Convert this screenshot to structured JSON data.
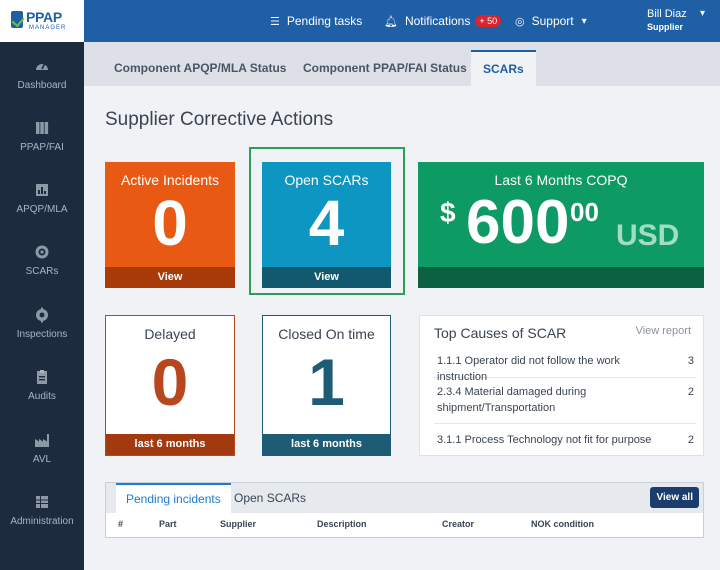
{
  "app": {
    "logo_text": "PPAP",
    "logo_sub": "MANAGER"
  },
  "topnav": {
    "pending_label": "Pending tasks",
    "pending_icon": "list-icon",
    "notifications_label": "Notifications",
    "notifications_badge": "+ 50",
    "notifications_icon": "bell-icon",
    "support_label": "Support",
    "support_icon": "headset-icon"
  },
  "user": {
    "name": "Bill Diaz",
    "role": "Supplier"
  },
  "sidebar": {
    "items": [
      {
        "label": "Dashboard",
        "icon": "speedometer-icon"
      },
      {
        "label": "PPAP/FAI",
        "icon": "binders-icon"
      },
      {
        "label": "APQP/MLA",
        "icon": "chart-doc-icon"
      },
      {
        "label": "SCARs",
        "icon": "target-icon"
      },
      {
        "label": "Inspections",
        "icon": "gear-check-icon"
      },
      {
        "label": "Audits",
        "icon": "clipboard-icon"
      },
      {
        "label": "AVL",
        "icon": "factory-icon"
      },
      {
        "label": "Administration",
        "icon": "table-icon"
      }
    ]
  },
  "tabs": [
    {
      "label": "Component APQP/MLA Status"
    },
    {
      "label": "Component PPAP/FAI Status"
    },
    {
      "label": "SCARs"
    }
  ],
  "page_title": "Supplier Corrective Actions",
  "cards": {
    "active": {
      "title": "Active Incidents",
      "value": "0",
      "foot": "View",
      "color": "#e85a13"
    },
    "open": {
      "title": "Open SCARs",
      "value": "4",
      "foot": "View",
      "color": "#0e96c3"
    },
    "copq": {
      "title": "Last 6 Months COPQ",
      "symbol": "$",
      "value": "600",
      "cents": "00",
      "currency": "USD",
      "color": "#0d9a64"
    },
    "delayed": {
      "title": "Delayed",
      "value": "0",
      "foot": "last 6 months",
      "color": "#b8471d"
    },
    "closed": {
      "title": "Closed On time",
      "value": "1",
      "foot": "last 6 months",
      "color": "#1d5c74"
    }
  },
  "causes": {
    "title": "Top Causes of SCAR",
    "link": "View report",
    "items": [
      {
        "text": "1.1.1 Operator did not follow the work instruction",
        "count": "3"
      },
      {
        "text": "2.3.4 Material damaged during shipment/Transportation",
        "count": "2"
      },
      {
        "text": "3.1.1 Process Technology not fit for purpose",
        "count": "2"
      }
    ]
  },
  "incidents": {
    "tabs": [
      "Pending incidents",
      "Open SCARs"
    ],
    "view_all": "View all",
    "columns": [
      "#",
      "Part",
      "Supplier",
      "Description",
      "Creator",
      "NOK condition"
    ]
  }
}
